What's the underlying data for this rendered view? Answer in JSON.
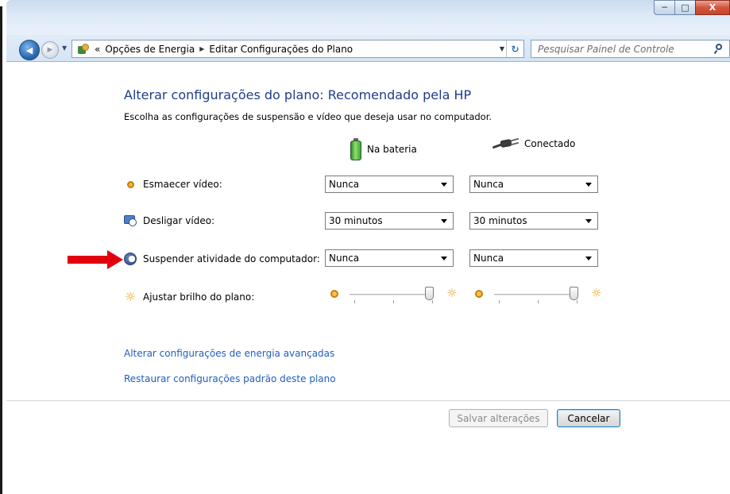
{
  "window": {
    "controls": {
      "minimize_glyph": "─",
      "maximize_glyph": "□",
      "close_glyph": "X"
    }
  },
  "navigation": {
    "back_glyph": "◀",
    "forward_glyph": "▶",
    "breadcrumb": {
      "overflow": "«",
      "items": [
        "Opções de Energia",
        "Editar Configurações do Plano"
      ],
      "separator": "▶"
    },
    "refresh_glyph": "↻",
    "search": {
      "placeholder": "Pesquisar Painel de Controle"
    }
  },
  "page": {
    "title": "Alterar configurações do plano: Recomendado pela HP",
    "subtitle": "Escolha as configurações de suspensão e vídeo que deseja usar no computador.",
    "columns": {
      "battery": "Na bateria",
      "plugged": "Conectado"
    },
    "settings": [
      {
        "label": "Esmaecer vídeo:",
        "battery": "Nunca",
        "plugged": "Nunca"
      },
      {
        "label": "Desligar vídeo:",
        "battery": "30 minutos",
        "plugged": "30 minutos"
      },
      {
        "label": "Suspender atividade do computador:",
        "battery": "Nunca",
        "plugged": "Nunca"
      }
    ],
    "brightness": {
      "label": "Ajustar brilho do plano:",
      "battery_level": 1.0,
      "plugged_level": 1.0
    },
    "links": {
      "advanced": "Alterar configurações de energia avançadas",
      "restore": "Restaurar configurações padrão deste plano"
    },
    "buttons": {
      "save": "Salvar alterações",
      "cancel": "Cancelar"
    }
  },
  "colors": {
    "heading": "#1e3c8c",
    "link": "#1f5fbf",
    "annotation_arrow": "#e2000f"
  }
}
